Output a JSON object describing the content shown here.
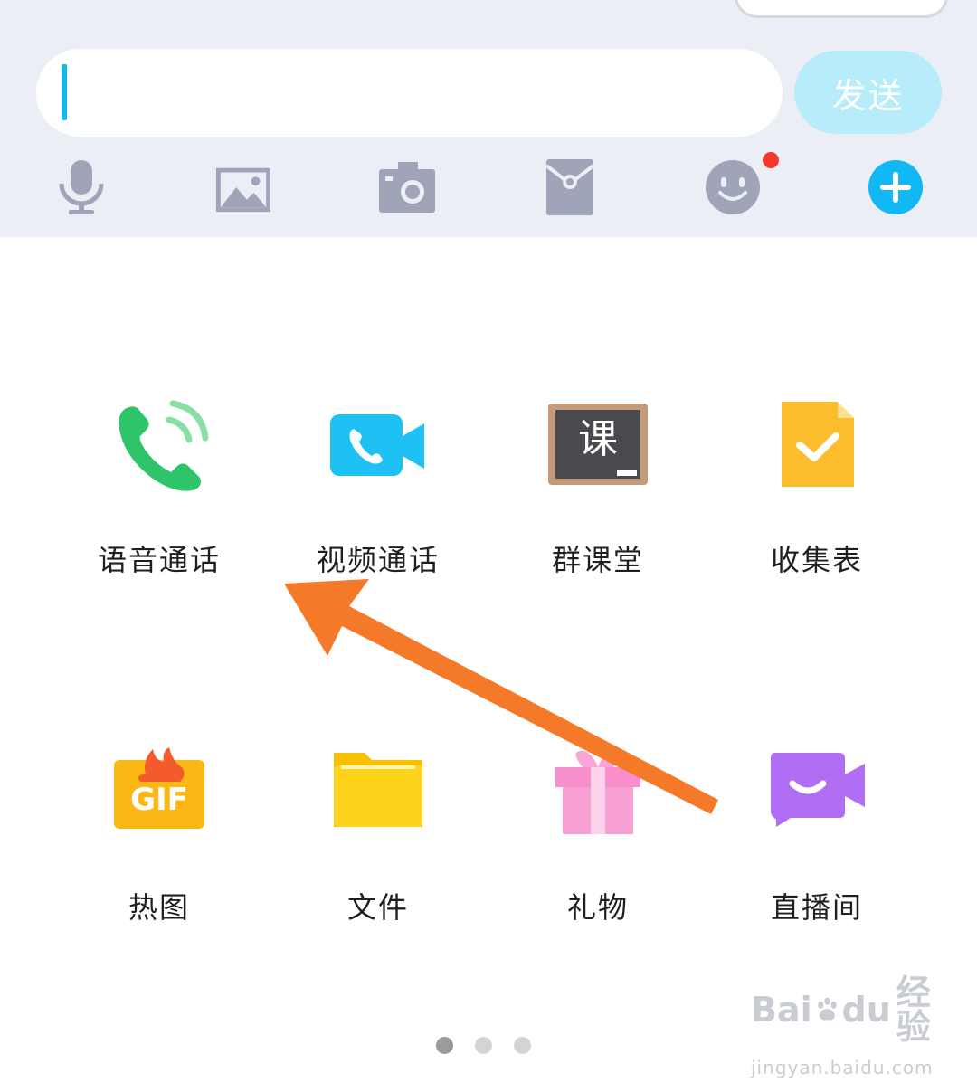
{
  "input": {
    "value": "",
    "placeholder": ""
  },
  "send_label": "发送",
  "toolbar": {
    "items": [
      {
        "icon": "microphone-icon"
      },
      {
        "icon": "image-icon"
      },
      {
        "icon": "camera-icon"
      },
      {
        "icon": "red-packet-icon"
      },
      {
        "icon": "emoji-icon",
        "badge": true
      },
      {
        "icon": "plus-icon"
      }
    ]
  },
  "apps": [
    {
      "label": "语音通话",
      "icon": "phone-call-icon"
    },
    {
      "label": "视频通话",
      "icon": "video-call-icon"
    },
    {
      "label": "群课堂",
      "icon": "classroom-icon",
      "icon_text": "课"
    },
    {
      "label": "收集表",
      "icon": "form-icon"
    },
    {
      "label": "热图",
      "icon": "hot-gif-icon",
      "icon_text": "GIF"
    },
    {
      "label": "文件",
      "icon": "folder-icon"
    },
    {
      "label": "礼物",
      "icon": "gift-icon"
    },
    {
      "label": "直播间",
      "icon": "live-room-icon"
    }
  ],
  "pager": {
    "total": 3,
    "active": 0
  },
  "watermark": {
    "brand": "Bai",
    "brand2": "du",
    "suffix": "经验",
    "url": "jingyan.baidu.com"
  },
  "colors": {
    "accent": "#12b7f5",
    "send_disabled": "#b7ecfb",
    "arrow": "#f47a2a",
    "badge": "#f23a2c"
  }
}
